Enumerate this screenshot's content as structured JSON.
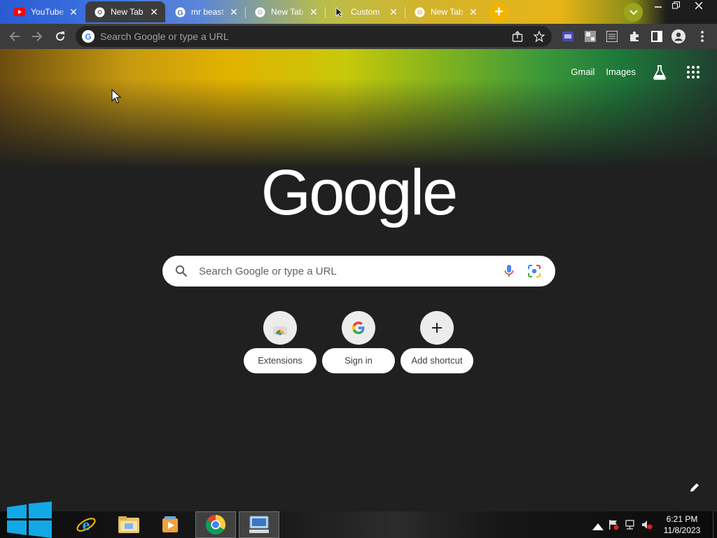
{
  "browser": {
    "tabs": [
      {
        "title": "YouTube",
        "favicon": "youtube-icon"
      },
      {
        "title": "New Tab",
        "favicon": "chrome-icon",
        "active": true
      },
      {
        "title": "mr beast",
        "favicon": "google-g-icon"
      },
      {
        "title": "New Tab",
        "favicon": "chrome-icon"
      },
      {
        "title": "Custom",
        "favicon": "cursor-icon"
      },
      {
        "title": "New Tab",
        "favicon": "chrome-icon"
      }
    ],
    "omnibox_placeholder": "Search Google or type a URL"
  },
  "newtab": {
    "top_links": {
      "gmail": "Gmail",
      "images": "Images"
    },
    "logo_text": "Google",
    "search_placeholder": "Search Google or type a URL",
    "shortcuts": [
      {
        "label": "Extensions",
        "icon": "web-store-icon"
      },
      {
        "label": "Sign in",
        "icon": "google-g-icon"
      },
      {
        "label": "Add shortcut",
        "icon": "plus-icon"
      }
    ]
  },
  "taskbar": {
    "apps": [
      "internet-explorer-icon",
      "file-explorer-icon",
      "media-player-icon",
      "chrome-icon",
      "remote-desktop-icon"
    ],
    "clock": {
      "time": "6:21 PM",
      "date": "11/8/2023"
    }
  },
  "colors": {
    "toolbar": "#3c3c3c",
    "page_bg": "#202020",
    "newtab_button": "#f2b400",
    "profile_button": "#9aa51c"
  }
}
